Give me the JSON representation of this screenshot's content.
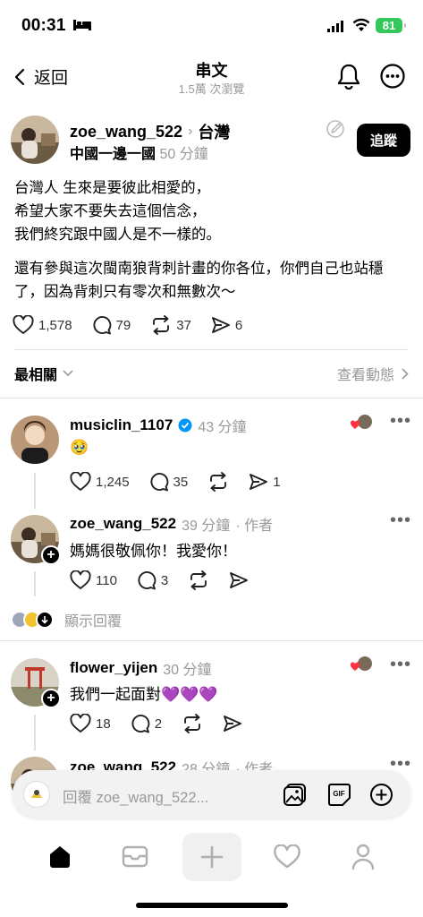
{
  "status_bar": {
    "time": "00:31",
    "battery": "81"
  },
  "header": {
    "back_label": "返回",
    "title": "串文",
    "subtitle": "1.5萬 次瀏覽"
  },
  "post": {
    "author": "zoe_wang_522",
    "location": "台灣",
    "tag": "中國一邊一國",
    "time_ago": "50 分鐘",
    "follow_label": "追蹤",
    "lines": [
      "台灣人 生來是要彼此相愛的，",
      "希望大家不要失去這個信念，",
      "我們終究跟中國人是不一樣的。"
    ],
    "paragraph2": "還有參與這次閩南狼背刺計畫的你各位，你們自己也站穩了，因為背刺只有零次和無數次～",
    "likes": "1,578",
    "comments": "79",
    "reposts": "37",
    "shares": "6"
  },
  "sort": {
    "label": "最相關",
    "activity": "查看動態"
  },
  "comments": [
    {
      "author": "musiclin_1107",
      "time_ago": "43 分鐘",
      "text": "🥹",
      "likes": "1,245",
      "comments": "35",
      "shares": "1"
    },
    {
      "author": "zoe_wang_522",
      "time_ago": "39 分鐘",
      "author_tag": "· 作者",
      "text": "媽媽很敬佩你！我愛你！",
      "likes": "110",
      "comments": "3"
    },
    {
      "author": "flower_yijen",
      "time_ago": "30 分鐘",
      "text": "我們一起面對💜💜💜",
      "likes": "18",
      "comments": "2"
    },
    {
      "author": "zoe_wang_522",
      "time_ago": "28 分鐘",
      "author_tag": "· 作者"
    }
  ],
  "show_replies": "顯示回覆",
  "reply_bar": {
    "placeholder": "回覆 zoe_wang_522..."
  },
  "icons": {
    "like": "heart-icon",
    "comment": "comment-icon",
    "repost": "repost-icon",
    "share": "send-icon",
    "home": "home-icon",
    "inbox": "mail-icon",
    "new": "plus-icon",
    "activity": "heart-icon",
    "profile": "person-icon"
  },
  "colors": {
    "verified": "#0095f6",
    "battery": "#34c759",
    "follow_bg": "#000000"
  }
}
